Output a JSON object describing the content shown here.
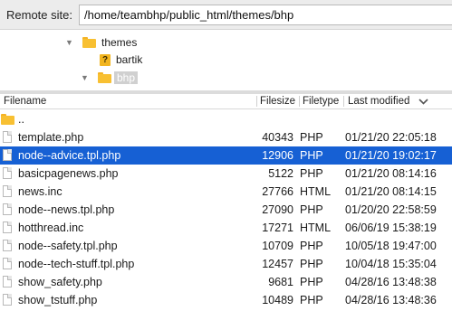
{
  "remote_site": {
    "label": "Remote site:",
    "path": "/home/teambhp/public_html/themes/bhp"
  },
  "tree": [
    {
      "label": "themes",
      "icon": "folder-icon",
      "expanded": true
    },
    {
      "label": "bartik",
      "icon": "unknown-folder-icon",
      "expanded": false
    },
    {
      "label": "bhp",
      "icon": "folder-icon",
      "expanded": true,
      "selected": true
    }
  ],
  "columns": {
    "filename": "Filename",
    "filesize": "Filesize",
    "filetype": "Filetype",
    "modified": "Last modified",
    "sort_indicator": "chevron-down-icon"
  },
  "files": [
    {
      "name": "..",
      "size": "",
      "type": "",
      "modified": "",
      "icon": "folder-icon"
    },
    {
      "name": "template.php",
      "size": "40343",
      "type": "PHP",
      "modified": "01/21/20 22:05:18",
      "icon": "file-icon"
    },
    {
      "name": "node--advice.tpl.php",
      "size": "12906",
      "type": "PHP",
      "modified": "01/21/20 19:02:17",
      "icon": "file-icon",
      "selected": true
    },
    {
      "name": "basicpagenews.php",
      "size": "5122",
      "type": "PHP",
      "modified": "01/21/20 08:14:16",
      "icon": "file-icon"
    },
    {
      "name": "news.inc",
      "size": "27766",
      "type": "HTML",
      "modified": "01/21/20 08:14:15",
      "icon": "file-icon"
    },
    {
      "name": "node--news.tpl.php",
      "size": "27090",
      "type": "PHP",
      "modified": "01/20/20 22:58:59",
      "icon": "file-icon"
    },
    {
      "name": "hotthread.inc",
      "size": "17271",
      "type": "HTML",
      "modified": "06/06/19 15:38:19",
      "icon": "file-icon"
    },
    {
      "name": "node--safety.tpl.php",
      "size": "10709",
      "type": "PHP",
      "modified": "10/05/18 19:47:00",
      "icon": "file-icon"
    },
    {
      "name": "node--tech-stuff.tpl.php",
      "size": "12457",
      "type": "PHP",
      "modified": "10/04/18 15:35:04",
      "icon": "file-icon"
    },
    {
      "name": "show_safety.php",
      "size": "9681",
      "type": "PHP",
      "modified": "04/28/16 13:48:38",
      "icon": "file-icon"
    },
    {
      "name": "show_tstuff.php",
      "size": "10489",
      "type": "PHP",
      "modified": "04/28/16 13:48:36",
      "icon": "file-icon"
    }
  ],
  "colors": {
    "selection": "#1660d4",
    "folder": "#f8c032"
  }
}
